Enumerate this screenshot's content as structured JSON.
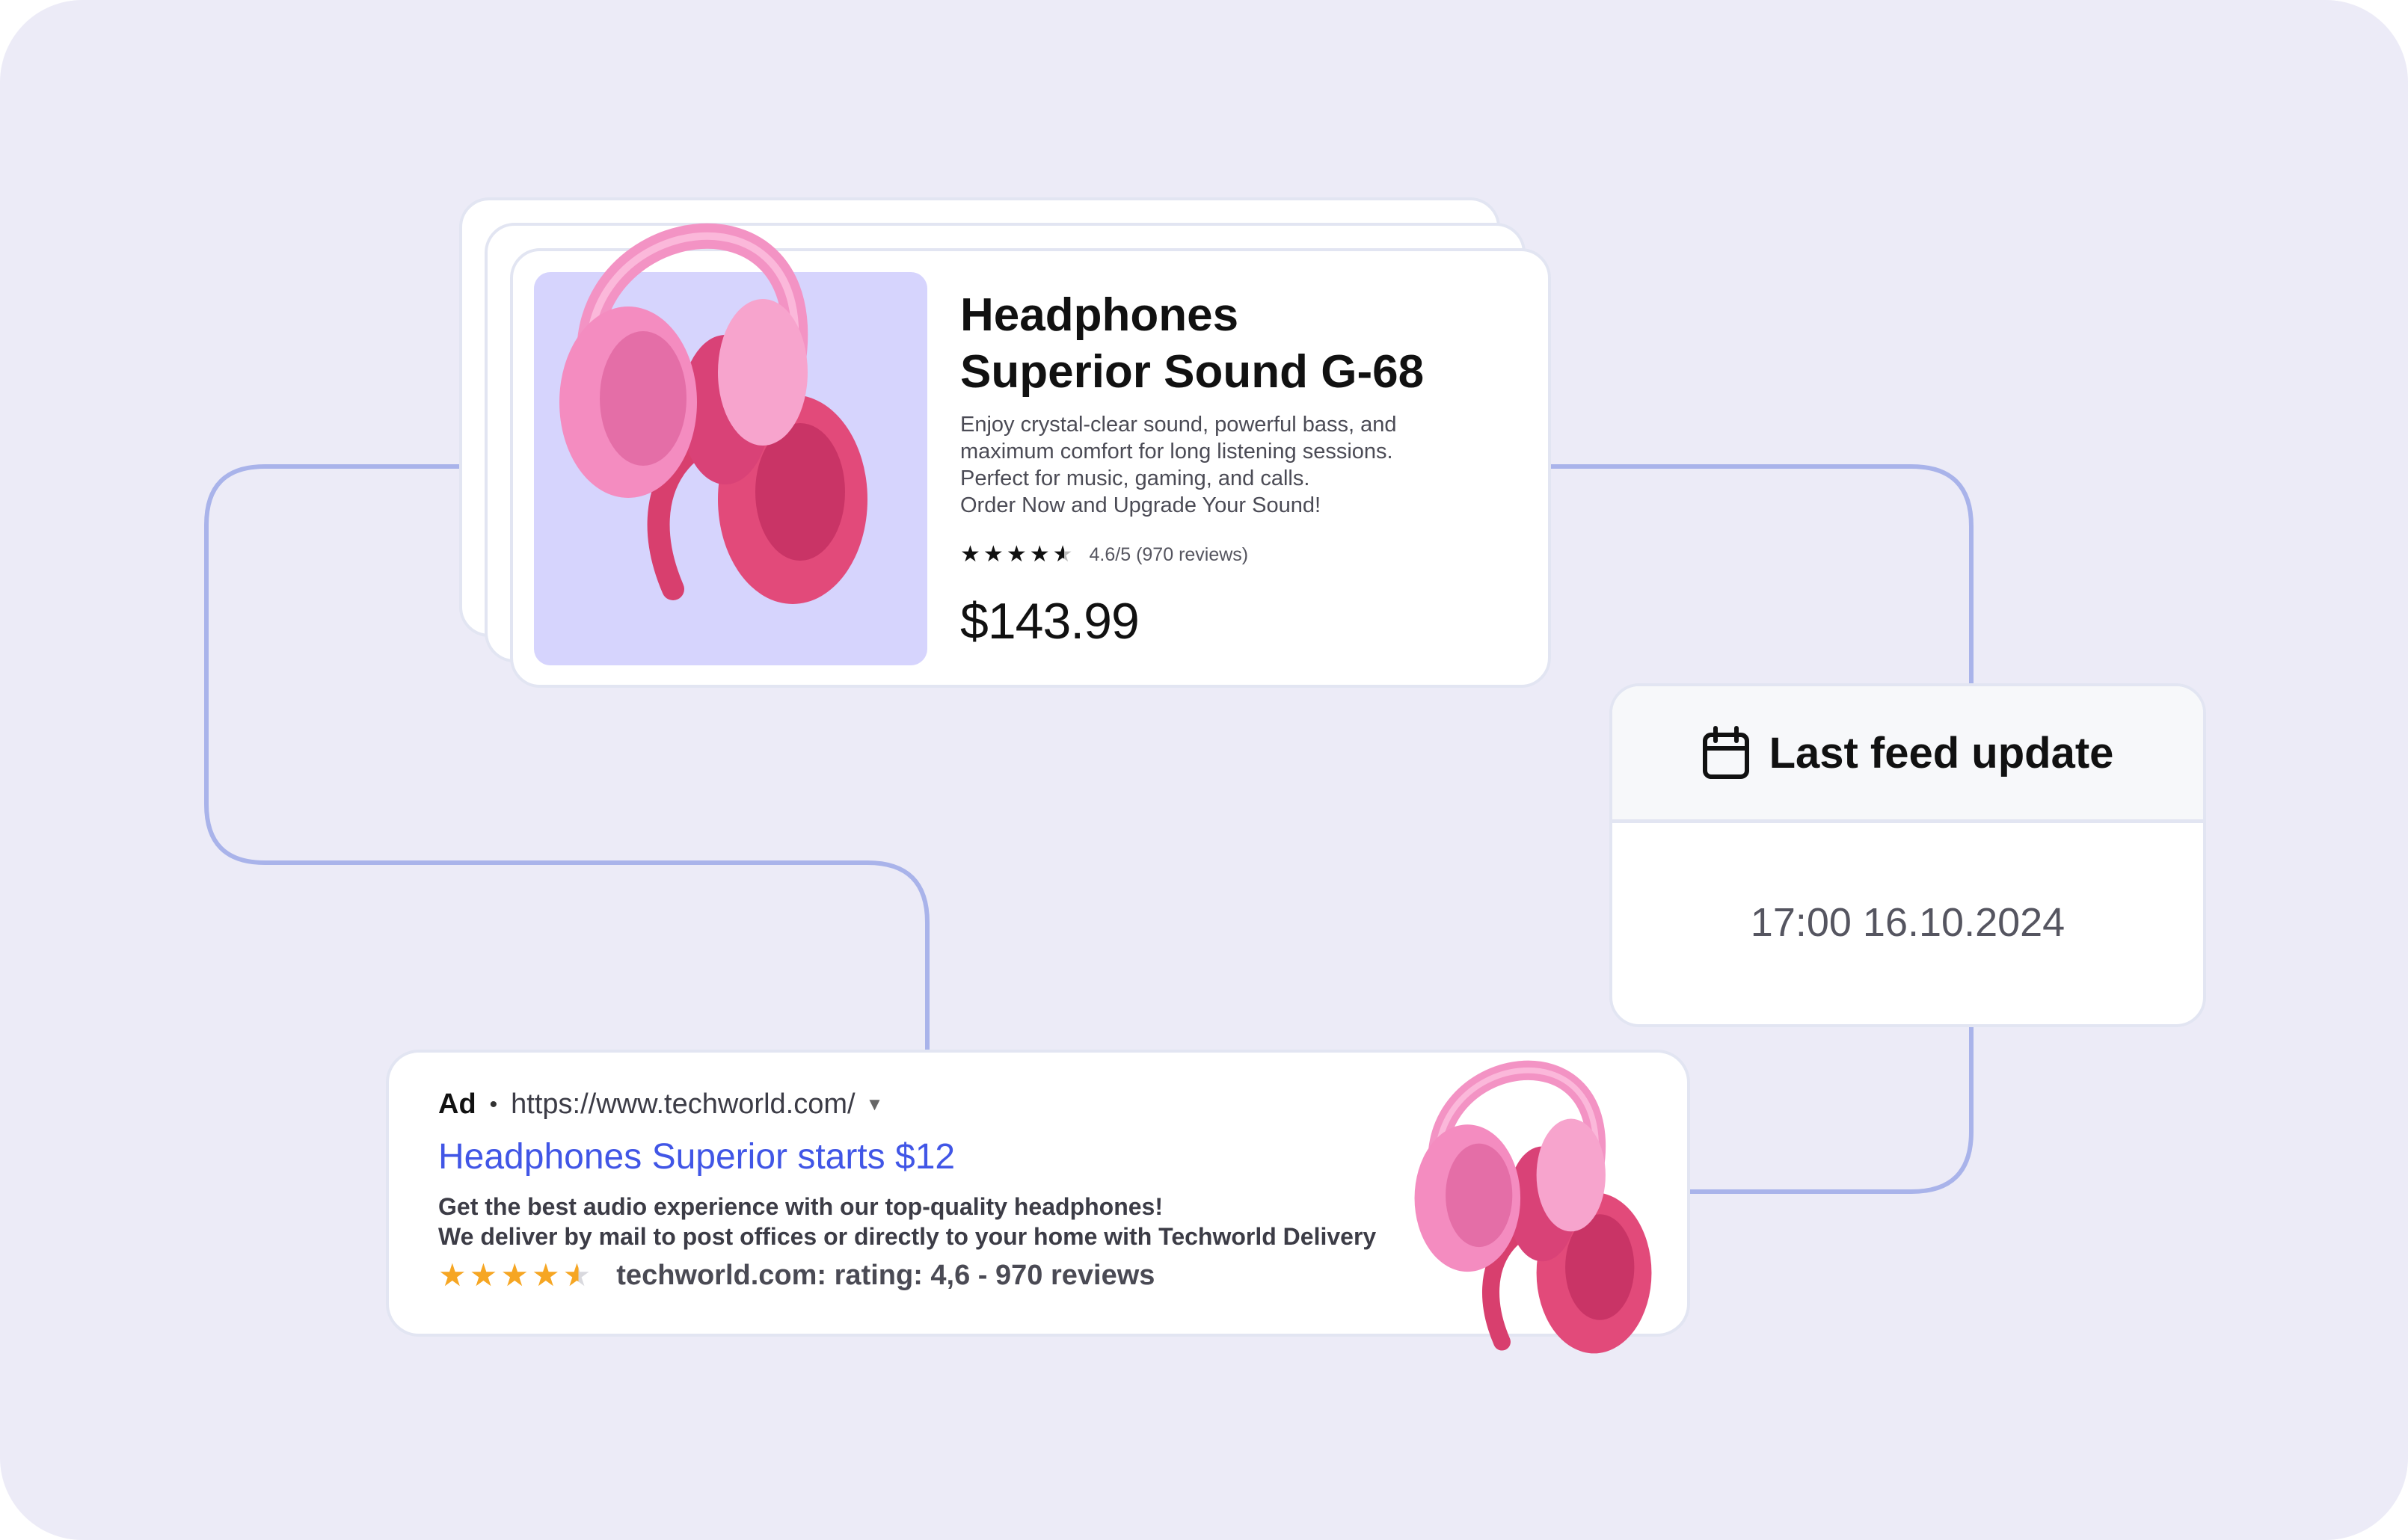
{
  "product": {
    "title_line1": "Headphones",
    "title_line2": "Superior Sound G-68",
    "description": [
      "Enjoy crystal-clear sound, powerful bass, and",
      "maximum comfort for long listening sessions.",
      "Perfect for music, gaming, and calls.",
      "Order Now and Upgrade Your Sound!"
    ],
    "rating_text": "4.6/5 (970 reviews)",
    "rating_value": 4.6,
    "price": "$143.99"
  },
  "feed": {
    "title": "Last feed update",
    "timestamp": "17:00 16.10.2024",
    "icon": "calendar-icon"
  },
  "ad": {
    "label": "Ad",
    "url": "https://www.techworld.com/",
    "headline": "Headphones Superior starts $12",
    "description_line1": "Get the best audio experience with our top-quality headphones!",
    "description_line2": "We deliver by mail to post offices or directly to your home with Techworld Delivery",
    "rating_text": "techworld.com: rating: 4,6 - 970 reviews",
    "rating_value": 4.6
  },
  "colors": {
    "background": "#ecebf7",
    "connector": "#a9b3ea",
    "product_image_bg": "#d6d4fd",
    "ad_headline": "#4156e6",
    "star_gold": "#f6a623",
    "headphone_pink": "#f48cc0",
    "headphone_red": "#e24a7a"
  }
}
